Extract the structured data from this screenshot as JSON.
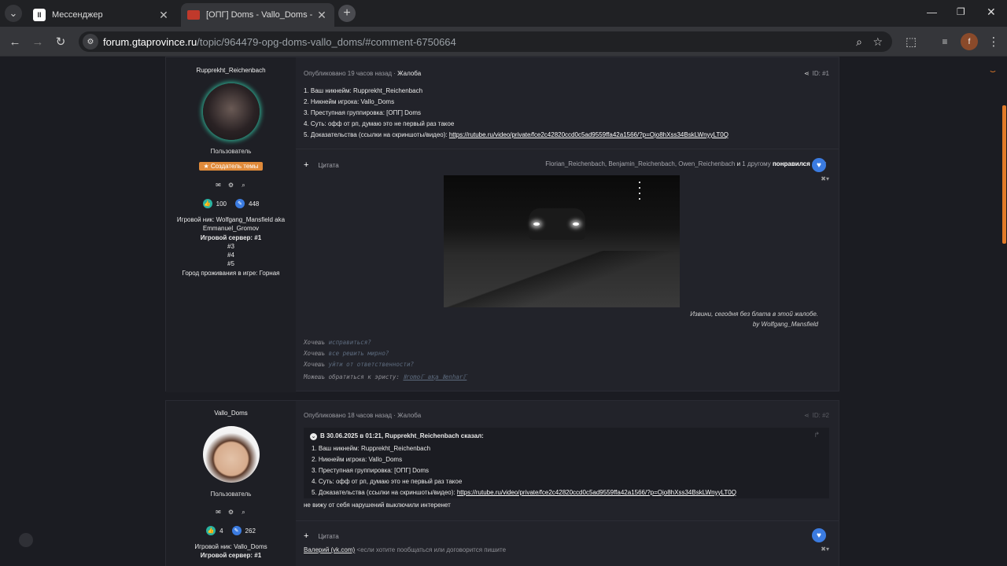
{
  "browser": {
    "tabs": [
      {
        "title": "Мессенджер",
        "active": false
      },
      {
        "title": "[ОПГ] Doms - Vallo_Doms - Все",
        "active": true
      }
    ],
    "url_domain": "forum.gtaprovince.ru",
    "url_path": "/topic/964479-opg-doms-vallo_doms/#comment-6750664",
    "profile_letter": "f"
  },
  "post1": {
    "author": "Rupprekht_Reichenbach",
    "role": "Пользователь",
    "badge": "★ Создатель темы",
    "likes": "100",
    "posts": "448",
    "info": {
      "nick_line1": "Игровой ник: Wolfgang_Mansfield aka",
      "nick_line2": "Emmanuel_Gromov",
      "server_label": "Игровой сервер: #1",
      "servers": [
        "#3",
        "#4",
        "#5"
      ],
      "city": "Город проживания в игре: Горная"
    },
    "meta_posted": "Опубликовано 19 часов назад",
    "meta_sep": " · ",
    "meta_complaint": "Жалоба",
    "id": "ID: #1",
    "lines": [
      "1. Ваш никнейм: Rupprekht_Reichenbach",
      "2. Никнейм игрока: Vallo_Doms",
      "3. Преступная группировка: [ОПГ] Doms",
      "4. Суть: офф от рп, думаю это не первый раз такое"
    ],
    "evidence_label": "5. Доказательства (ссылки на скриншоты/видео): ",
    "evidence_link": "https://rutube.ru/video/private/fce2c42820ccd0c5ad9559ffa42a1566/?p=Ojo8hXss34BskLWnyyLT0Q",
    "quote_label": "Цитата",
    "likers": "Florian_Reichenbach, Benjamin_Reichenbach, Owen_Reichenbach",
    "likers_and": " и ",
    "likers_more": "1 другому",
    "likers_action": " понравился пост",
    "sig_caption1": "Извини, сегодня без блата в этой жалобе.",
    "sig_caption2": "by Wolfgang_Mansfield",
    "sig_lines": [
      {
        "a": "Хочешь ",
        "b": "исправиться?"
      },
      {
        "a": "Хочешь ",
        "b": "все решить мирно?"
      },
      {
        "a": "Хочешь ",
        "b": "уйти от ответственности?"
      }
    ],
    "sig_contact": "Можешь обратиться к эристу: ",
    "sig_contact_link": "Ⅱromoℾ aⱩa Ⅱenharℾ"
  },
  "post2": {
    "author": "Vallo_Doms",
    "role": "Пользователь",
    "likes": "4",
    "posts": "262",
    "info": {
      "nick_line1": "Игровой ник: Vallo_Doms",
      "server_label": "Игровой сервер: #1"
    },
    "meta_posted": "Опубликовано 18 часов назад",
    "meta_sep": " · ",
    "meta_complaint": "Жалоба",
    "id": "ID: #2",
    "quote_header": "В 30.06.2025 в 01:21, Rupprekht_Reichenbach сказал:",
    "quote_lines": [
      "1. Ваш никнейм: Rupprekht_Reichenbach",
      "2. Никнейм игрока: Vallo_Doms",
      "3. Преступная группировка: [ОПГ] Doms",
      "4. Суть: офф от рп, думаю это не первый раз такое"
    ],
    "quote_evidence_label": "5. Доказательства (ссылки на скриншоты/видео): ",
    "quote_evidence_link": "https://rutube.ru/video/private/fce2c42820ccd0c5ad9559ffa42a1566/?p=Ojo8hXss34BskLWnyyLT0Q",
    "reply": "не вижу от себя нарушений выключили интеренет",
    "quote_label": "Цитата",
    "sig_link": "Валерий (vk.com)",
    "sig_text": " <если хотите пообщаться или договорится пишите"
  }
}
